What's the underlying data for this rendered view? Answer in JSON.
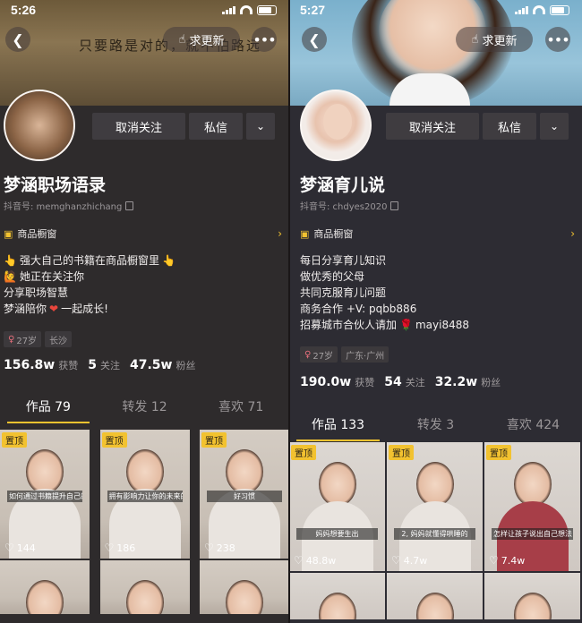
{
  "left": {
    "status_time": "5:26",
    "cover_text": "只要路是对的，就不怕路远",
    "update_label": "求更新",
    "unfollow_label": "取消关注",
    "dm_label": "私信",
    "name": "梦涵职场语录",
    "account": "抖音号: memghanzhichang",
    "shop_label": "商品橱窗",
    "bio": [
      "强大自己的书籍在商品橱窗里",
      "她正在关注你",
      "分享职场智慧",
      "梦涵陪你",
      "一起成长!"
    ],
    "tags": [
      "27岁",
      "长沙"
    ],
    "stats": [
      {
        "num": "156.8w",
        "label": "获赞"
      },
      {
        "num": "5",
        "label": "关注"
      },
      {
        "num": "47.5w",
        "label": "粉丝"
      }
    ],
    "tabs": [
      "作品 79",
      "转发 12",
      "喜欢 71"
    ],
    "pin_label": "置顶",
    "videos": [
      {
        "caption": "如何通过书籍提升自己的书",
        "likes": "144"
      },
      {
        "caption": "拥有影响力让你的未来的",
        "likes": "186"
      },
      {
        "caption": "好习惯",
        "likes": "238"
      }
    ]
  },
  "right": {
    "status_time": "5:27",
    "update_label": "求更新",
    "unfollow_label": "取消关注",
    "dm_label": "私信",
    "name": "梦涵育儿说",
    "account": "抖音号: chdyes2020",
    "shop_label": "商品橱窗",
    "bio": [
      "每日分享育儿知识",
      "做优秀的父母",
      "共同克服育儿问题",
      "商务合作 +V: pqbb886",
      "招募城市合伙人请加",
      "mayi8488"
    ],
    "tags": [
      "27岁",
      "广东·广州"
    ],
    "stats": [
      {
        "num": "190.0w",
        "label": "获赞"
      },
      {
        "num": "54",
        "label": "关注"
      },
      {
        "num": "32.2w",
        "label": "粉丝"
      }
    ],
    "tabs": [
      "作品 133",
      "转发 3",
      "喜欢 424"
    ],
    "pin_label": "置顶",
    "videos": [
      {
        "caption": "妈妈想要生出",
        "likes": "48.8w"
      },
      {
        "caption": "2, 妈妈就懂得哄睡的",
        "likes": "4.7w"
      },
      {
        "caption": "怎样让孩子说出自己想法",
        "likes": "7.4w"
      }
    ]
  }
}
